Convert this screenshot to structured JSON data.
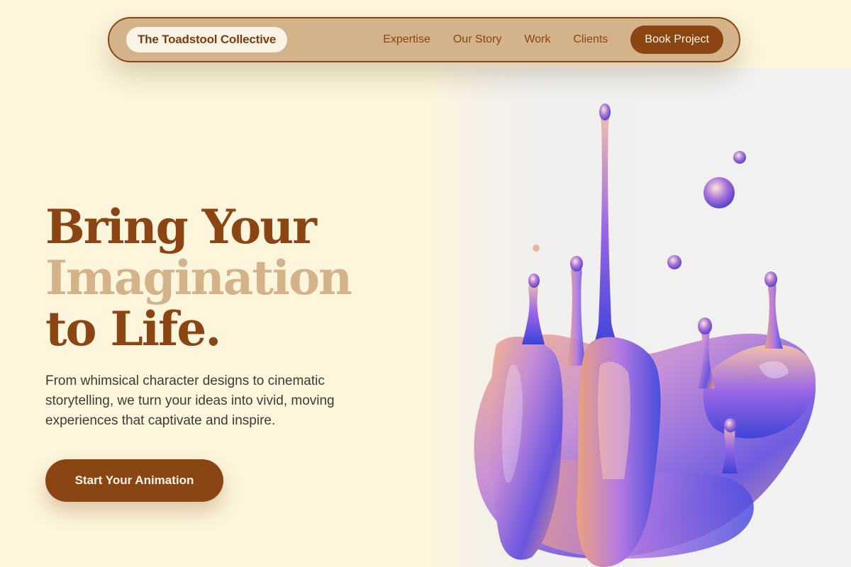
{
  "nav": {
    "brand": "The Toadstool Collective",
    "links": [
      "Expertise",
      "Our Story",
      "Work",
      "Clients"
    ],
    "cta_label": "Book Project"
  },
  "hero": {
    "title_line1": "Bring Your",
    "title_line2": "Imagination",
    "title_line3": "to Life.",
    "subtitle": "From whimsical character designs to cinematic storytelling, we turn your ideas into vivid, moving experiences that captivate and inspire.",
    "cta_label": "Start Your Animation"
  },
  "colors": {
    "background": "#fdf6dc",
    "brand_brown": "#8b4513",
    "tan": "#d4b28a",
    "text_dark": "#3e3a36"
  }
}
